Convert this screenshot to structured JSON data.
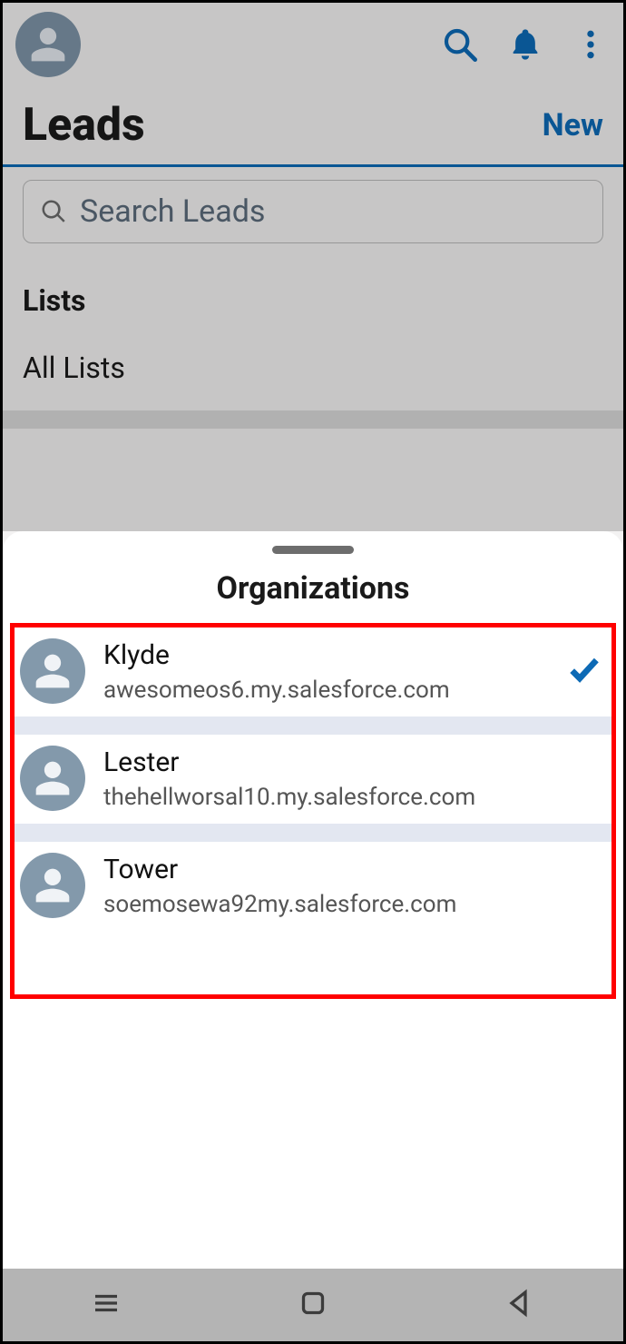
{
  "header": {
    "title": "Leads",
    "new_label": "New"
  },
  "search": {
    "placeholder": "Search Leads"
  },
  "lists": {
    "section_label": "Lists",
    "all_lists_label": "All Lists"
  },
  "sheet": {
    "title": "Organizations",
    "orgs": [
      {
        "name": "Klyde",
        "domain": "awesomeos6.my.salesforce.com",
        "selected": true
      },
      {
        "name": "Lester",
        "domain": "thehellworsal10.my.salesforce.com",
        "selected": false
      },
      {
        "name": "Tower",
        "domain": "soemosewa92my.salesforce.com",
        "selected": false
      }
    ]
  }
}
